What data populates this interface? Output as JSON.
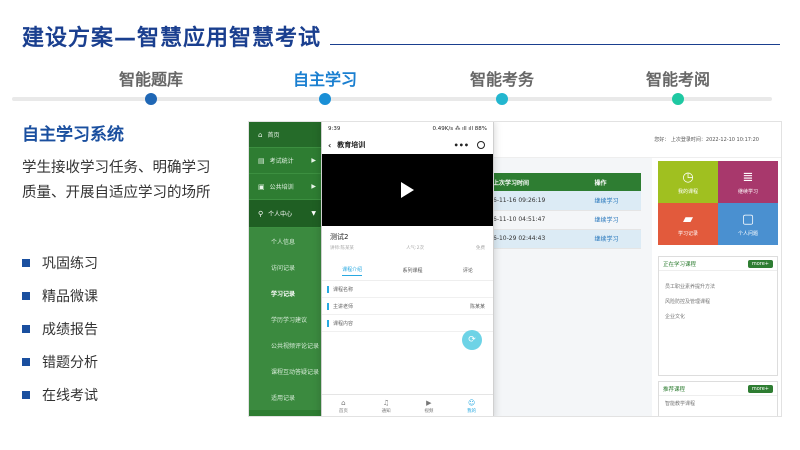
{
  "header": {
    "title": "建设方案—智慧应用智慧考试"
  },
  "timeline": {
    "steps": [
      {
        "label": "智能题库",
        "color": "#1f67b5",
        "active": false
      },
      {
        "label": "自主学习",
        "color": "#1a8fd6",
        "active": true
      },
      {
        "label": "智能考务",
        "color": "#23b6cf",
        "active": false
      },
      {
        "label": "智能考阅",
        "color": "#1ec8a2",
        "active": false
      }
    ]
  },
  "left": {
    "heading": "自主学习系统",
    "description": "学生接收学习任务、明确学习质量、开展自适应学习的场所",
    "features": [
      "巩固练习",
      "精品微课",
      "成绩报告",
      "错题分析",
      "在线考试"
    ]
  },
  "sidebar": {
    "items": [
      {
        "label": "首页",
        "icon": "home-icon",
        "glyph": "⌂"
      },
      {
        "label": "考试统计",
        "icon": "stats-icon",
        "glyph": "▤"
      },
      {
        "label": "公共培训",
        "icon": "training-icon",
        "glyph": "▣"
      }
    ],
    "group": {
      "label": "个人中心",
      "icon": "user-search-icon",
      "glyph": "⚲"
    },
    "subitems": [
      "个人信息",
      "访问记录",
      "学习记录",
      "学历学习建议",
      "公共视频评论记录",
      "课程互动答疑记录",
      "适用记录"
    ],
    "active_sub": 2
  },
  "desktop": {
    "user_text": "您好：        上次登录时间：2022-12-10 10:17:20",
    "table": {
      "headers": [
        "上次学习时间",
        "操作"
      ],
      "rows": [
        {
          "time": "6-11-16 09:26:19",
          "op": "继续学习"
        },
        {
          "time": "6-11-10 04:51:47",
          "op": "继续学习"
        },
        {
          "time": "6-10-29 02:44:43",
          "op": "继续学习"
        }
      ]
    },
    "tiles": [
      {
        "label": "我的课程",
        "color": "#a0c020",
        "icon": "clock-icon",
        "glyph": "◷"
      },
      {
        "label": "继续学习",
        "color": "#a8386c",
        "icon": "books-icon",
        "glyph": "≣"
      },
      {
        "label": "学习记录",
        "color": "#e25a3c",
        "icon": "folder-icon",
        "glyph": "▰"
      },
      {
        "label": "个人问题",
        "color": "#4a90d0",
        "icon": "chat-icon",
        "glyph": "▢"
      }
    ],
    "learning_box": {
      "title": "正在学习课程",
      "more": "more+",
      "rows": [
        "员工职业素养提升方法",
        "风险防控及管理课程",
        "企业文化"
      ]
    },
    "recommend_box": {
      "title": "推荐课程",
      "more": "more+",
      "rows": [
        "智能教学课程"
      ]
    }
  },
  "phone": {
    "status_time": "9:39",
    "status_right": "0.49K/s ⁂ ıll ıll 88%",
    "nav_title": "教育培训",
    "course_title": "测试2",
    "meta_left": "讲师:陈某某",
    "meta_mid": "人气:2次",
    "meta_right": "免费",
    "tabs": [
      "课程介绍",
      "系列课程",
      "评论"
    ],
    "fields": [
      {
        "label": "课程名称",
        "value": ""
      },
      {
        "label": "主讲老师",
        "value": "陈某某"
      },
      {
        "label": "课程内容",
        "value": ""
      }
    ],
    "bottom_nav": [
      {
        "label": "首页",
        "icon": "home-outline-icon",
        "glyph": "⌂"
      },
      {
        "label": "通知",
        "icon": "bell-icon",
        "glyph": "♫"
      },
      {
        "label": "视频",
        "icon": "video-icon",
        "glyph": "▶"
      },
      {
        "label": "我的",
        "icon": "person-icon",
        "glyph": "☺"
      }
    ]
  }
}
